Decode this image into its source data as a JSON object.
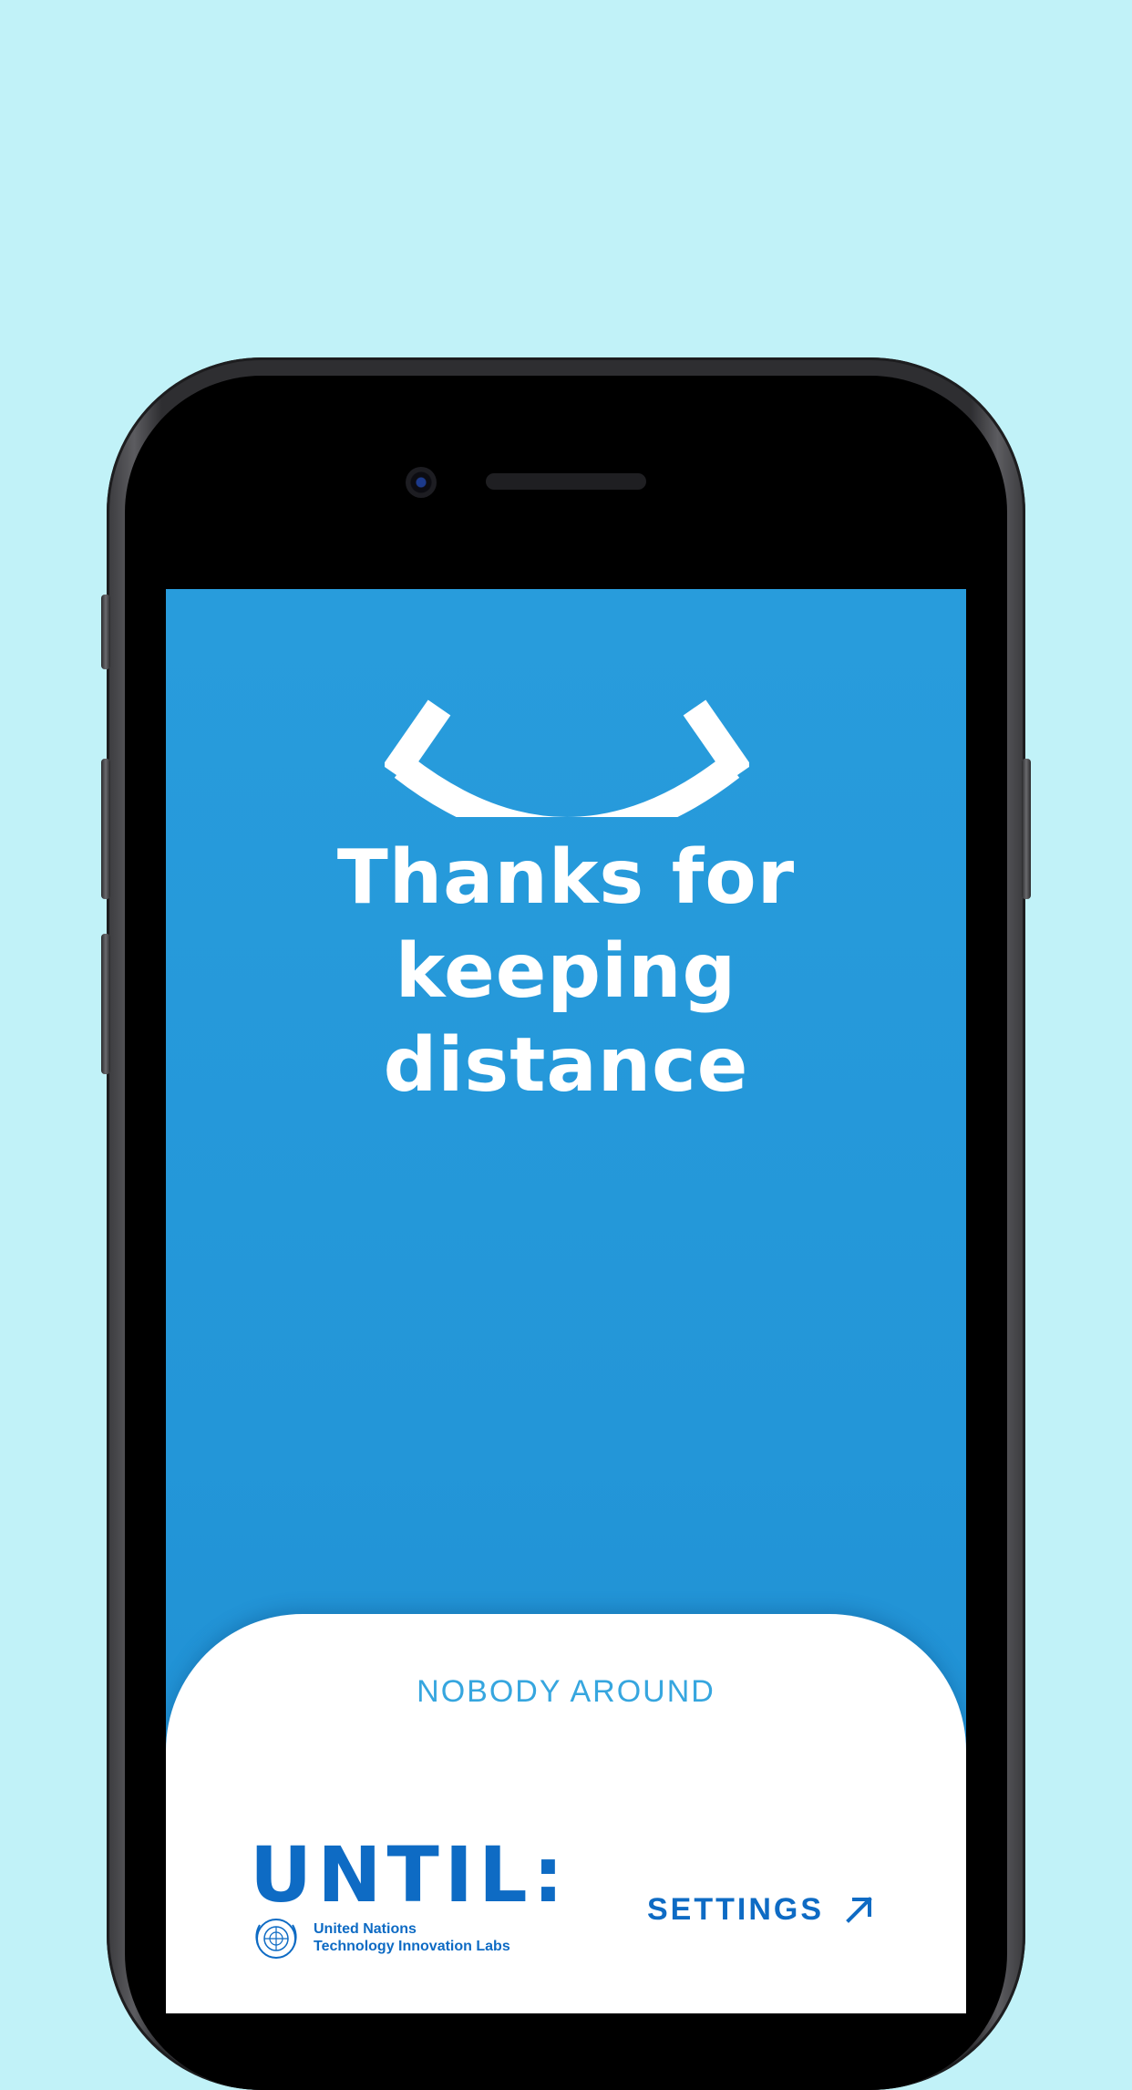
{
  "screen": {
    "headline": [
      "Thanks for",
      "keeping",
      "distance"
    ],
    "status": "NOBODY AROUND"
  },
  "brand": {
    "name": "UNTIL:",
    "org_line1": "United Nations",
    "org_line2": "Technology Innovation Labs"
  },
  "actions": {
    "settings_label": "SETTINGS",
    "settings_icon": "arrow-up-right-icon"
  },
  "icons": {
    "hero": "smile-icon",
    "emblem": "un-emblem-icon"
  },
  "colors": {
    "background": "#c1f2f8",
    "screen_blue": "#2396d8",
    "brand_blue": "#0e6bc4",
    "status_blue": "#36a6df"
  }
}
